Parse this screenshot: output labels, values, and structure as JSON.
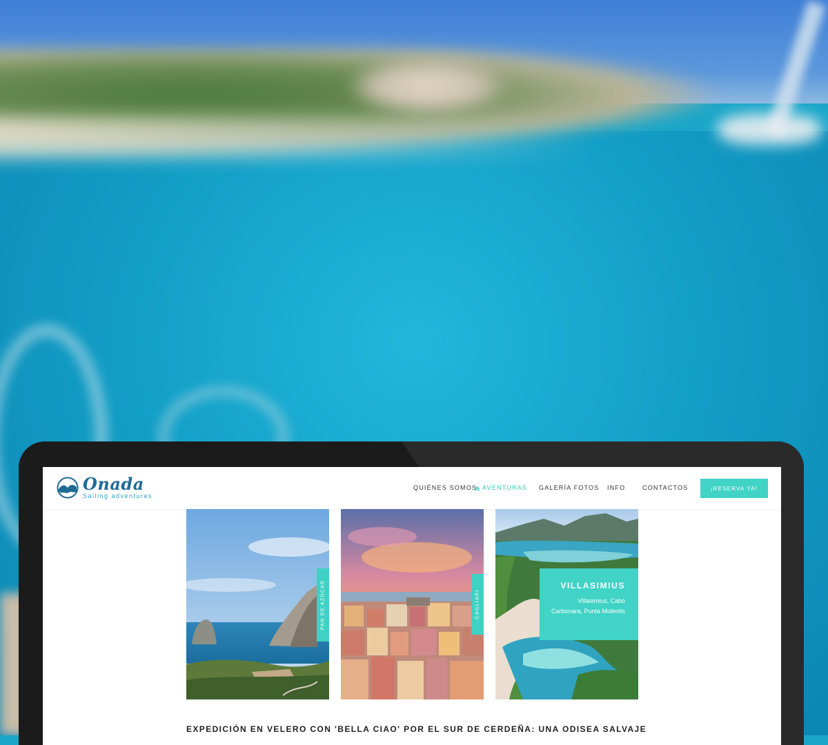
{
  "brand": {
    "name": "Onada",
    "tagline": "Sailing adventures",
    "color": "#1f6b96",
    "accent": "#40d3c6"
  },
  "nav": {
    "items": [
      {
        "label": "QUIÉNES SOMOS"
      },
      {
        "label": "AVENTURAS",
        "icon": "sailboat-icon"
      },
      {
        "label": "GALERÍA FOTOS"
      },
      {
        "label": "INFO"
      },
      {
        "label": "CONTACTOS"
      }
    ],
    "cta": "¡RESERVA YA!"
  },
  "cards": [
    {
      "label": "PAN DE AZÚCAR"
    },
    {
      "label": "CAGLIARI"
    },
    {
      "title": "VILLASIMIUS",
      "description": "Villasimius, Cabo Carbonara, Punta Molentis"
    }
  ],
  "headline": "EXPEDICIÓN EN VELERO CON 'BELLA CIAO' POR EL SUR DE CERDEÑA: UNA ODISEA SALVAJE"
}
